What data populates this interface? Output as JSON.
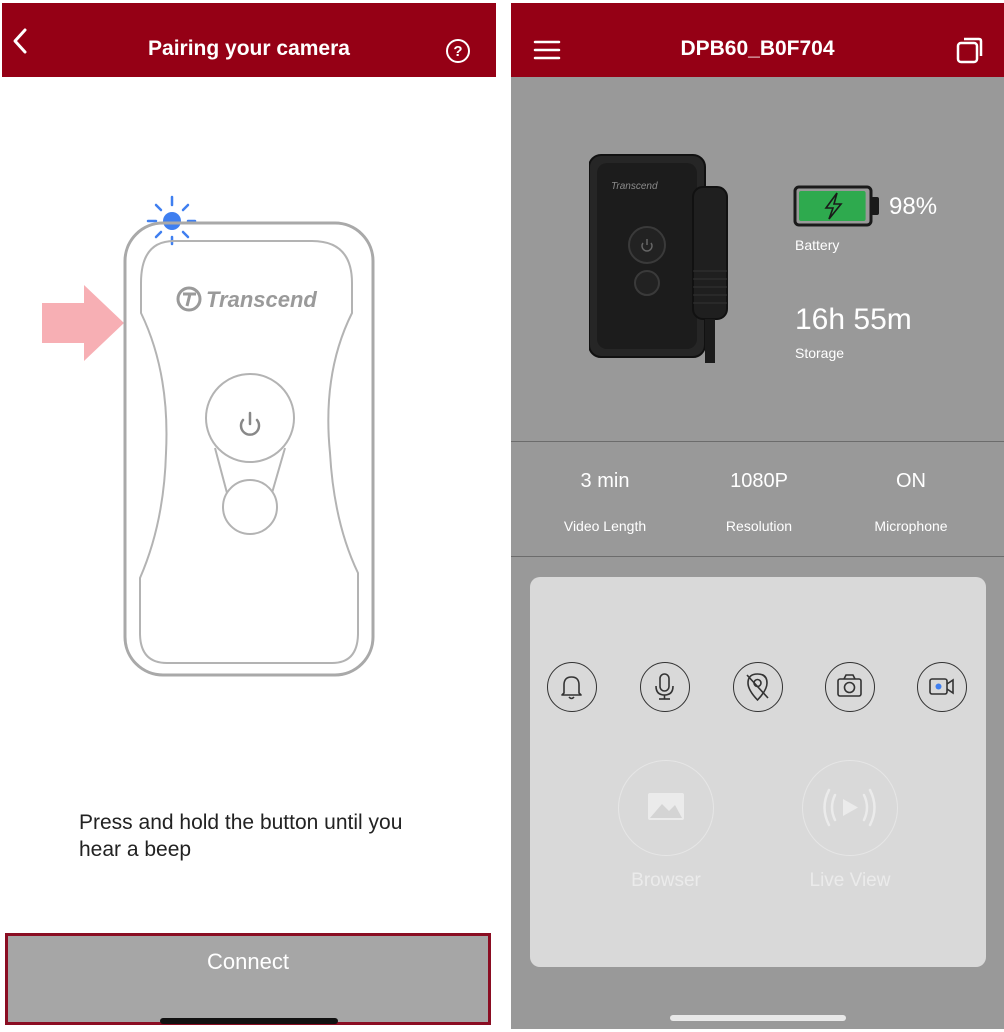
{
  "left_screen": {
    "header": {
      "title": "Pairing your camera"
    },
    "illustration": {
      "brand_text": "Transcend"
    },
    "instruction": "Press and hold the button until you hear a beep",
    "connect_label": "Connect"
  },
  "right_screen": {
    "header": {
      "title": "DPB60_B0F704"
    },
    "device": {
      "brand_text": "Transcend"
    },
    "battery": {
      "percent": "98%",
      "label": "Battery",
      "level": 0.98
    },
    "storage": {
      "value": "16h 55m",
      "label": "Storage"
    },
    "stats": [
      {
        "value": "3 min",
        "label": "Video Length"
      },
      {
        "value": "1080P",
        "label": "Resolution"
      },
      {
        "value": "ON",
        "label": "Microphone"
      }
    ],
    "quick_icons": [
      "bell-icon",
      "microphone-icon",
      "location-off-icon",
      "camera-icon",
      "video-record-icon"
    ],
    "actions": [
      {
        "label": "Browser",
        "icon": "gallery-icon"
      },
      {
        "label": "Live View",
        "icon": "live-broadcast-icon"
      }
    ]
  },
  "colors": {
    "header_red": "#950015",
    "battery_green": "#2eaa4e",
    "connect_border": "#8a0d22",
    "panel_gray": "#999999",
    "led_blue": "#3f7ff0"
  }
}
